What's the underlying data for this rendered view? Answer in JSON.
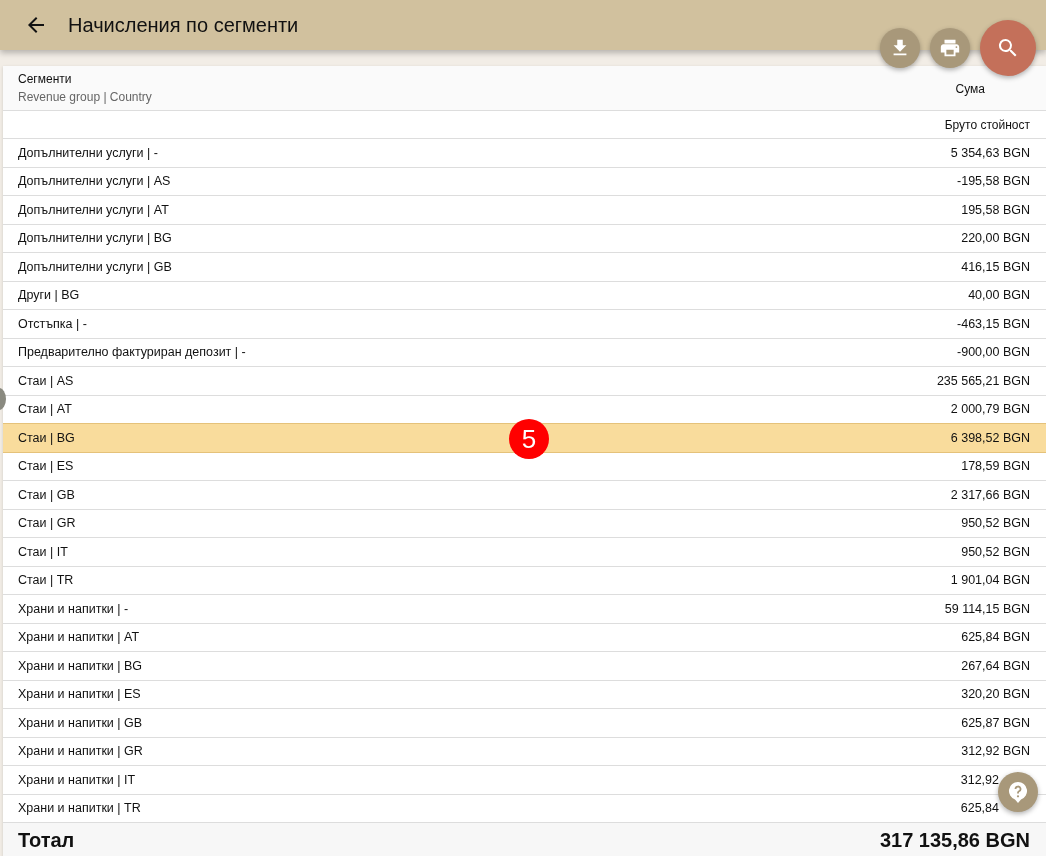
{
  "title": "Начисления по сегменти",
  "table": {
    "column_1": {
      "label": "Сегменти",
      "sublabel": "Revenue group | Country"
    },
    "column_2": {
      "label": "Сума",
      "sublabel": "Бруто стойност"
    },
    "rows": [
      {
        "segment": "Допълнителни услуги | -",
        "amount": "5 354,63 BGN",
        "selected": false
      },
      {
        "segment": "Допълнителни услуги | AS",
        "amount": "-195,58 BGN",
        "selected": false
      },
      {
        "segment": "Допълнителни услуги | AT",
        "amount": "195,58 BGN",
        "selected": false
      },
      {
        "segment": "Допълнителни услуги | BG",
        "amount": "220,00 BGN",
        "selected": false
      },
      {
        "segment": "Допълнителни услуги | GB",
        "amount": "416,15 BGN",
        "selected": false
      },
      {
        "segment": "Други | BG",
        "amount": "40,00 BGN",
        "selected": false
      },
      {
        "segment": "Отстъпка | -",
        "amount": "-463,15 BGN",
        "selected": false
      },
      {
        "segment": "Предварително фактуриран депозит | -",
        "amount": "-900,00 BGN",
        "selected": false
      },
      {
        "segment": "Стаи | AS",
        "amount": "235 565,21 BGN",
        "selected": false
      },
      {
        "segment": "Стаи | AT",
        "amount": "2 000,79 BGN",
        "selected": false
      },
      {
        "segment": "Стаи | BG",
        "amount": "6 398,52 BGN",
        "selected": true
      },
      {
        "segment": "Стаи | ES",
        "amount": "178,59 BGN",
        "selected": false
      },
      {
        "segment": "Стаи | GB",
        "amount": "2 317,66 BGN",
        "selected": false
      },
      {
        "segment": "Стаи | GR",
        "amount": "950,52 BGN",
        "selected": false
      },
      {
        "segment": "Стаи | IT",
        "amount": "950,52 BGN",
        "selected": false
      },
      {
        "segment": "Стаи | TR",
        "amount": "1 901,04 BGN",
        "selected": false
      },
      {
        "segment": "Храни и напитки | -",
        "amount": "59 114,15 BGN",
        "selected": false
      },
      {
        "segment": "Храни и напитки | AT",
        "amount": "625,84 BGN",
        "selected": false
      },
      {
        "segment": "Храни и напитки | BG",
        "amount": "267,64 BGN",
        "selected": false
      },
      {
        "segment": "Храни и напитки | ES",
        "amount": "320,20 BGN",
        "selected": false
      },
      {
        "segment": "Храни и напитки | GB",
        "amount": "625,87 BGN",
        "selected": false
      },
      {
        "segment": "Храни и напитки | GR",
        "amount": "312,92 BGN",
        "selected": false
      },
      {
        "segment": "Храни и напитки | IT",
        "amount": "312,92",
        "selected": false
      },
      {
        "segment": "Храни и напитки | TR",
        "amount": "625,84",
        "selected": false
      }
    ],
    "total": {
      "label": "Тотал",
      "amount": "317 135,86 BGN"
    }
  },
  "row_badge": "5"
}
